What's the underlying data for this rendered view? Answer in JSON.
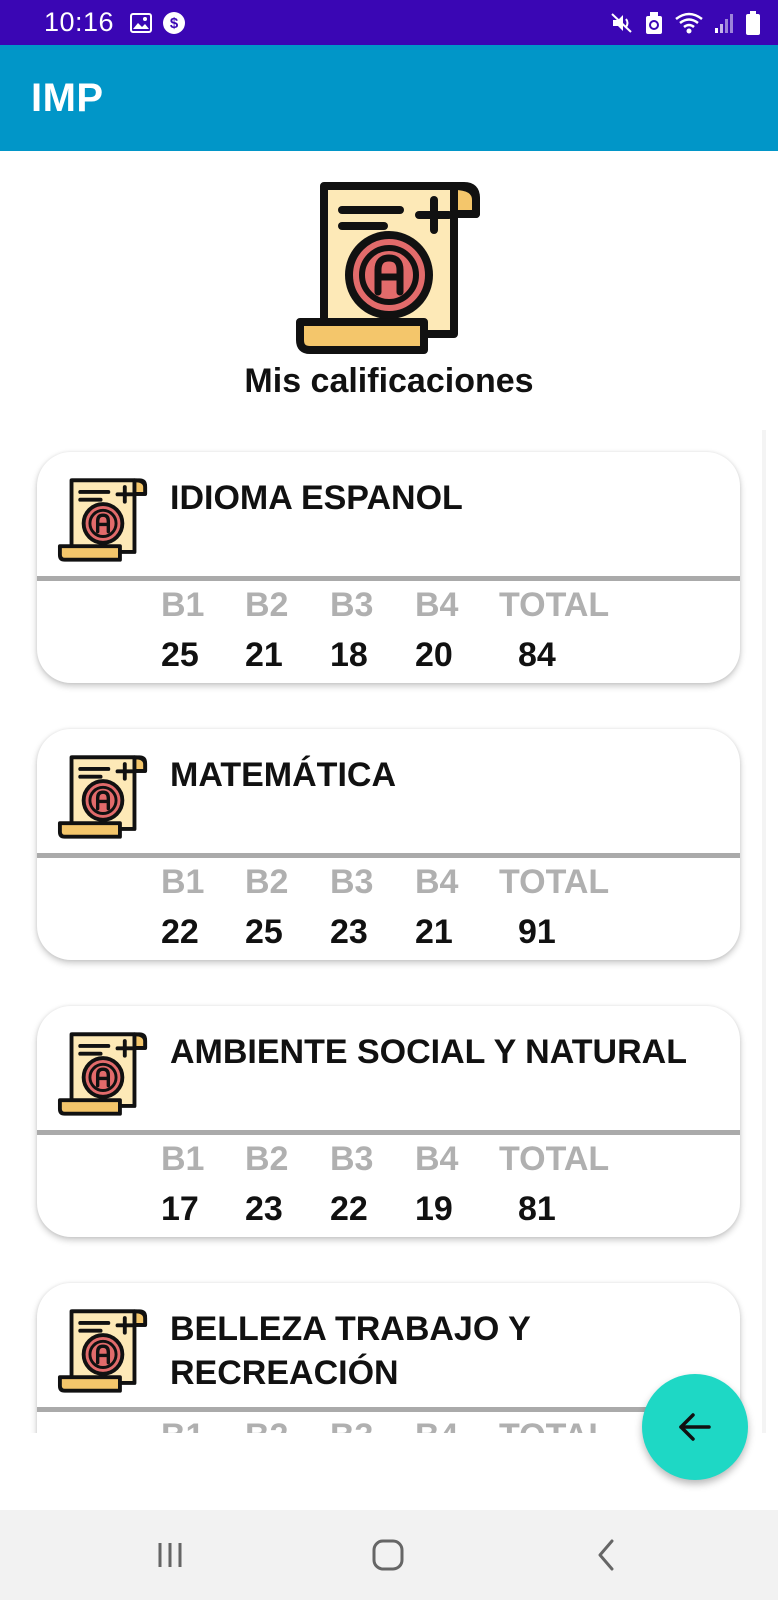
{
  "status_bar": {
    "time": "10:16",
    "left_icons": [
      "image-icon",
      "dollar-icon"
    ],
    "right_icons": [
      "mute-icon",
      "recycle-icon",
      "wifi-icon",
      "signal-icon",
      "battery-icon"
    ]
  },
  "app_bar": {
    "title": "IMP"
  },
  "header": {
    "icon": "grade-certificate-icon",
    "title": "Mis calificaciones"
  },
  "grade_headers": {
    "b1": "B1",
    "b2": "B2",
    "b3": "B3",
    "b4": "B4",
    "total": "TOTAL"
  },
  "subjects": [
    {
      "name": "IDIOMA ESPANOL",
      "b1": "25",
      "b2": "21",
      "b3": "18",
      "b4": "20",
      "total": "84"
    },
    {
      "name": "MATEMÁTICA",
      "b1": "22",
      "b2": "25",
      "b3": "23",
      "b4": "21",
      "total": "91"
    },
    {
      "name": "AMBIENTE SOCIAL Y NATURAL",
      "b1": "17",
      "b2": "23",
      "b3": "22",
      "b4": "19",
      "total": "81"
    },
    {
      "name_line1": "BELLEZA TRABAJO Y",
      "name_line2": "RECREACIÓN"
    }
  ],
  "fab": {
    "icon": "arrow-back-icon"
  },
  "nav_bar": {
    "icons": [
      "recent-apps-icon",
      "home-icon",
      "back-icon"
    ]
  },
  "colors": {
    "status_bar": "#3a06b4",
    "app_bar": "#0196c8",
    "fab": "#1ed8c5",
    "grade_label": "#b0b0b0",
    "icon_paper": "#fde9b7",
    "icon_badge": "#e26b6b"
  }
}
